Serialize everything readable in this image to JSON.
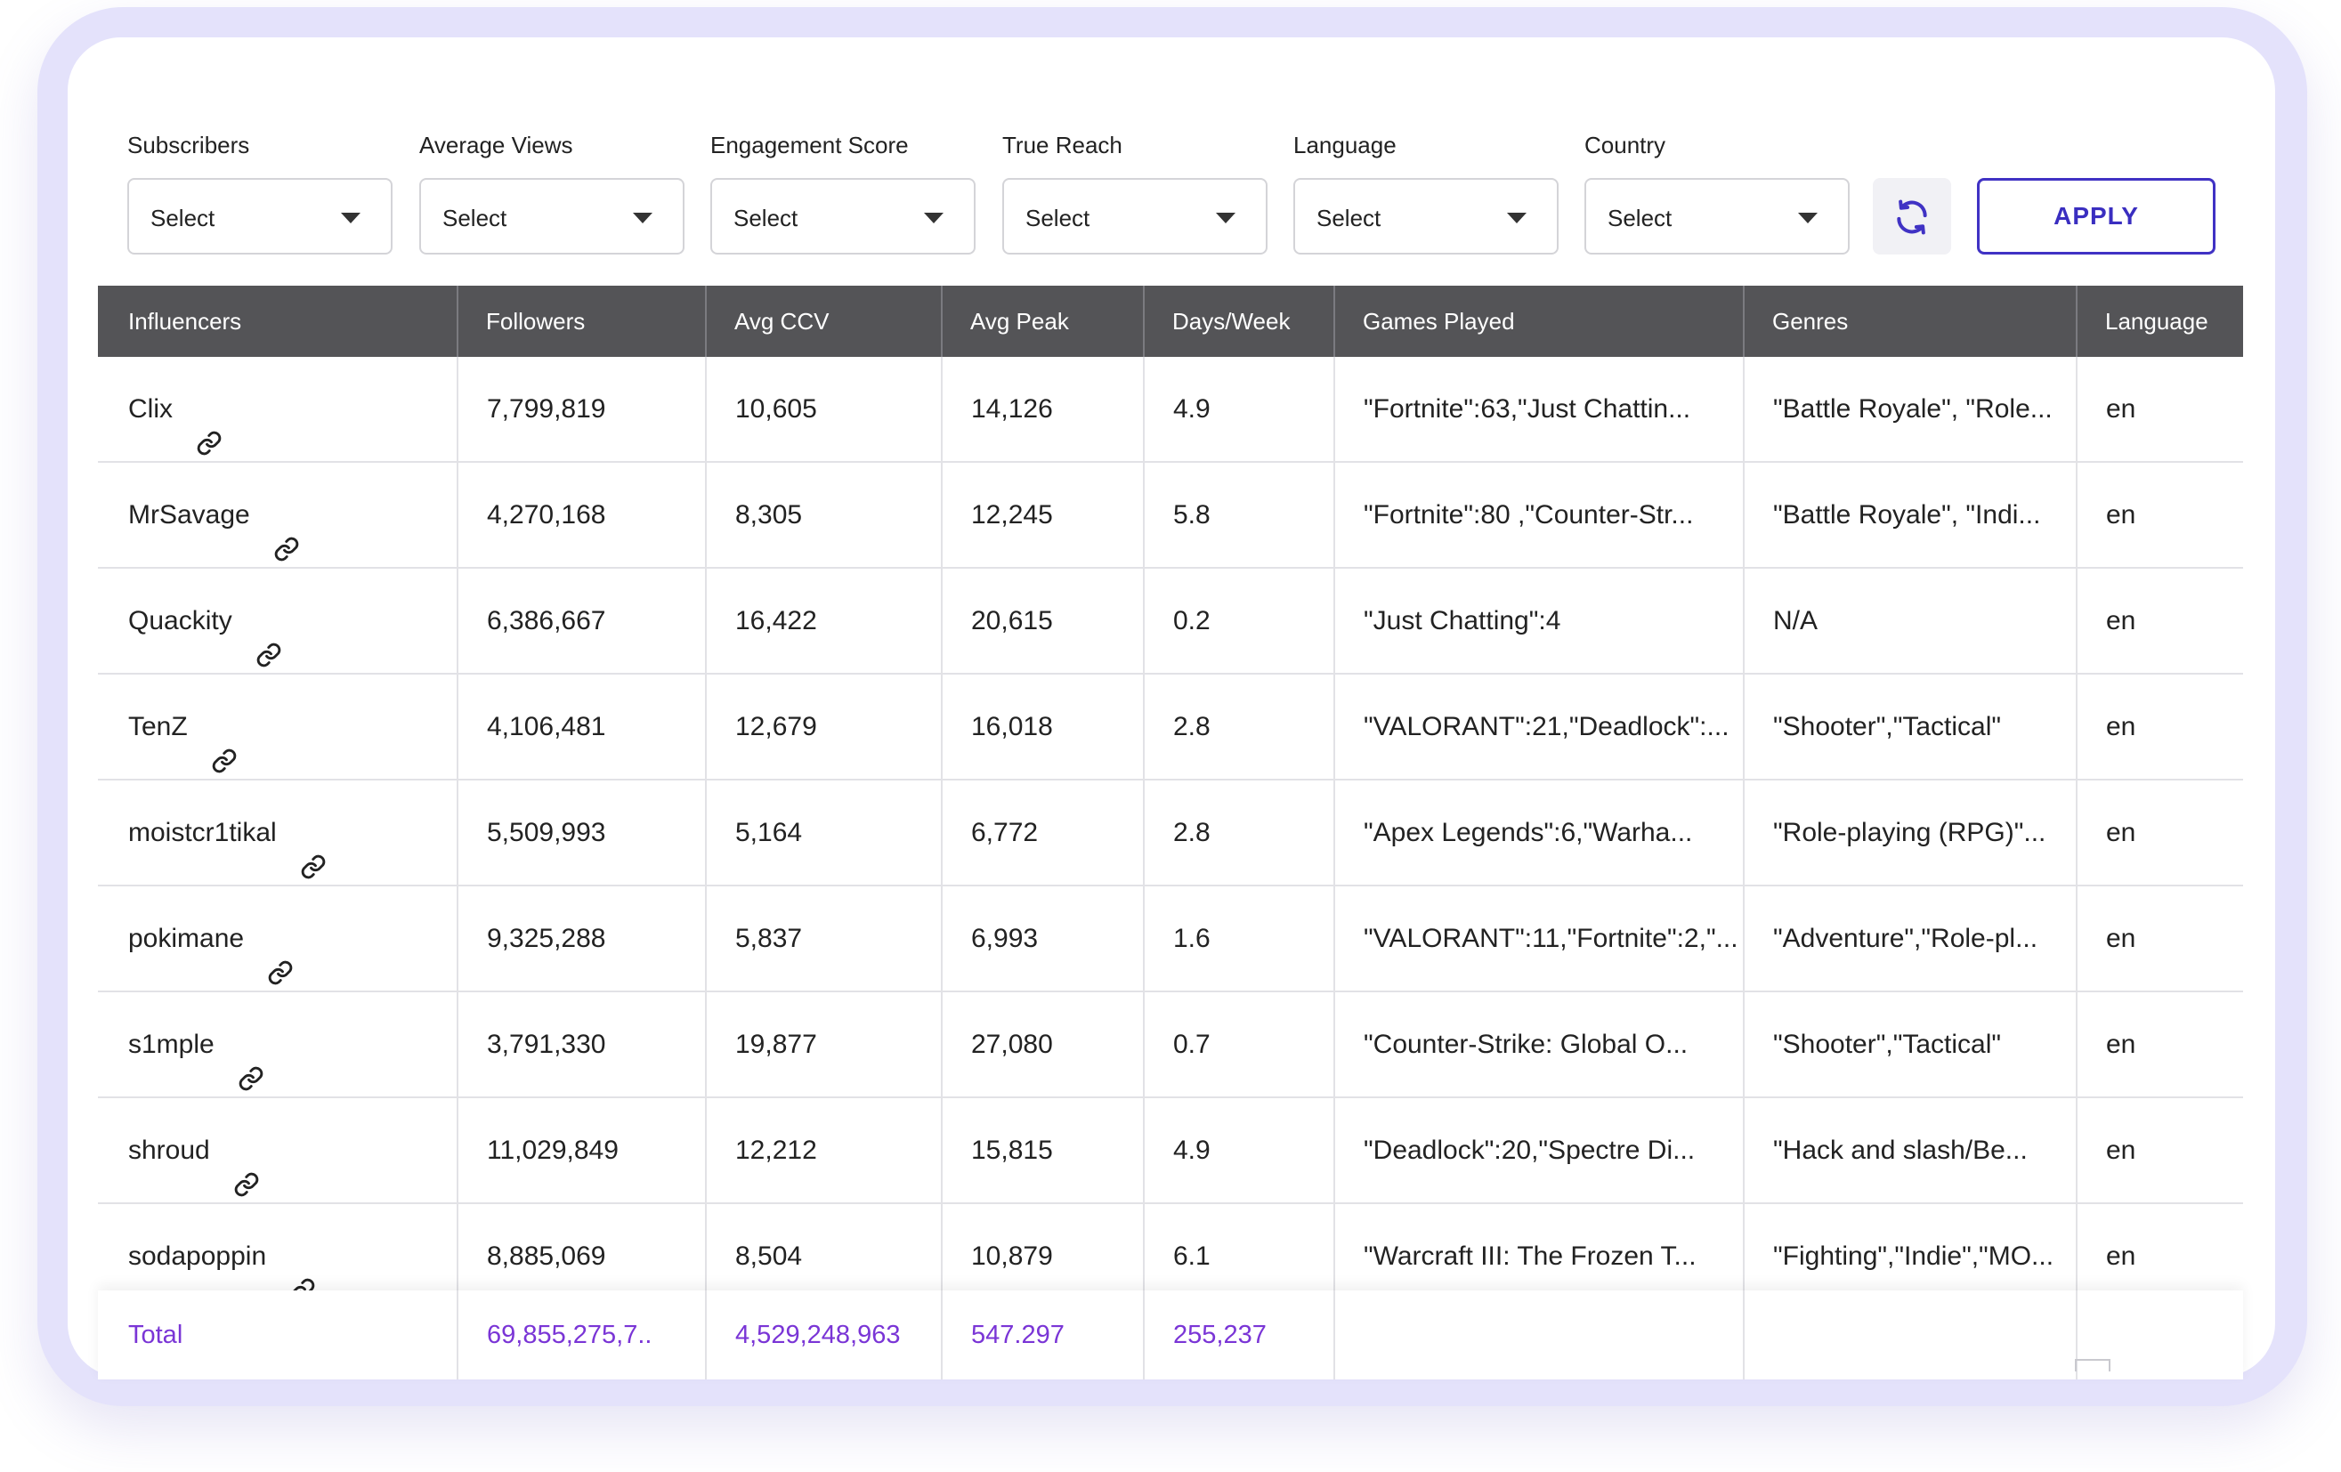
{
  "filters": [
    {
      "label": "Subscribers",
      "value": "Select"
    },
    {
      "label": "Average Views",
      "value": "Select"
    },
    {
      "label": "Engagement Score",
      "value": "Select"
    },
    {
      "label": "True Reach",
      "value": "Select"
    },
    {
      "label": "Language",
      "value": "Select"
    },
    {
      "label": "Country",
      "value": "Select"
    }
  ],
  "apply_label": "APPLY",
  "columns": [
    "Influencers",
    "Followers",
    "Avg CCV",
    "Avg Peak",
    "Days/Week",
    "Games Played",
    "Genres",
    "Language"
  ],
  "rows": [
    {
      "name": "Clix",
      "followers": "7,799,819",
      "avg_ccv": "10,605",
      "avg_peak": "14,126",
      "days_week": "4.9",
      "games": "\"Fortnite\":63,\"Just Chattin...",
      "genres": "\"Battle Royale\", \"Role...",
      "language": "en"
    },
    {
      "name": "MrSavage",
      "followers": "4,270,168",
      "avg_ccv": "8,305",
      "avg_peak": "12,245",
      "days_week": "5.8",
      "games": "\"Fortnite\":80 ,\"Counter-Str...",
      "genres": "\"Battle Royale\", \"Indi...",
      "language": "en"
    },
    {
      "name": "Quackity",
      "followers": "6,386,667",
      "avg_ccv": "16,422",
      "avg_peak": "20,615",
      "days_week": "0.2",
      "games": "\"Just Chatting\":4",
      "genres": "N/A",
      "language": "en"
    },
    {
      "name": "TenZ",
      "followers": "4,106,481",
      "avg_ccv": "12,679",
      "avg_peak": "16,018",
      "days_week": "2.8",
      "games": "\"VALORANT\":21,\"Deadlock\":...",
      "genres": "\"Shooter\",\"Tactical\"",
      "language": "en"
    },
    {
      "name": "moistcr1tikal",
      "followers": "5,509,993",
      "avg_ccv": "5,164",
      "avg_peak": "6,772",
      "days_week": "2.8",
      "games": "\"Apex Legends\":6,\"Warha...",
      "genres": "\"Role-playing (RPG)\"...",
      "language": "en"
    },
    {
      "name": "pokimane",
      "followers": "9,325,288",
      "avg_ccv": "5,837",
      "avg_peak": "6,993",
      "days_week": "1.6",
      "games": "\"VALORANT\":11,\"Fortnite\":2,\"...",
      "genres": "\"Adventure\",\"Role-pl...",
      "language": "en"
    },
    {
      "name": "s1mple",
      "followers": "3,791,330",
      "avg_ccv": "19,877",
      "avg_peak": "27,080",
      "days_week": "0.7",
      "games": "\"Counter-Strike: Global O...",
      "genres": "\"Shooter\",\"Tactical\"",
      "language": "en"
    },
    {
      "name": "shroud",
      "followers": "11,029,849",
      "avg_ccv": "12,212",
      "avg_peak": "15,815",
      "days_week": "4.9",
      "games": "\"Deadlock\":20,\"Spectre Di...",
      "genres": "\"Hack and slash/Be...",
      "language": "en"
    },
    {
      "name": "sodapoppin",
      "followers": "8,885,069",
      "avg_ccv": "8,504",
      "avg_peak": "10,879",
      "days_week": "6.1",
      "games": "\"Warcraft III: The Frozen T...",
      "genres": "\"Fighting\",\"Indie\",\"MO...",
      "language": "en"
    }
  ],
  "totals": {
    "label": "Total",
    "followers": "69,855,275,7..",
    "avg_ccv": "4,529,248,963",
    "avg_peak": "547.297",
    "days_week": "255,237"
  },
  "colors": {
    "accent": "#4032c4",
    "total_text": "#7a35d6",
    "header_bg": "#545457",
    "frame": "#e4e2fb"
  },
  "icons": {
    "refresh": "refresh-icon",
    "link": "link-icon",
    "dropdown": "chevron-down-icon"
  }
}
